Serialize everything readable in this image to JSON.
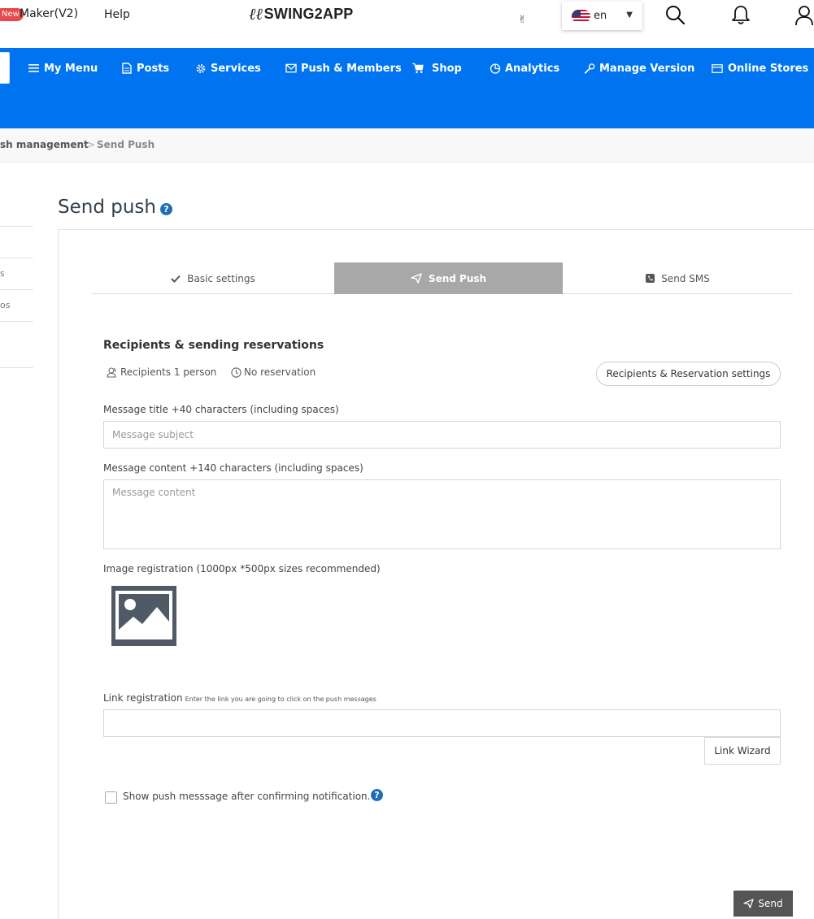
{
  "topbar": {
    "new_badge": "New",
    "maker_label": "Maker(V2)",
    "help_label": "Help",
    "logo_text": "SWING2APP",
    "language": {
      "label": "en",
      "flag": "us-flag-icon"
    },
    "icons": [
      "hand-icon",
      "search-icon",
      "bell-icon",
      "user-icon"
    ]
  },
  "nav": {
    "items": [
      {
        "label": "My Menu",
        "icon": "menu-icon"
      },
      {
        "label": "Posts",
        "icon": "document-icon"
      },
      {
        "label": "Services",
        "icon": "gear-icon"
      },
      {
        "label": "Push & Members",
        "icon": "mail-icon"
      },
      {
        "label": "Shop",
        "icon": "cart-icon"
      },
      {
        "label": "Analytics",
        "icon": "pie-chart-icon"
      },
      {
        "label": "Manage Version",
        "icon": "wrench-icon"
      },
      {
        "label": "Online Stores",
        "icon": "store-icon"
      }
    ]
  },
  "breadcrumb": {
    "parent": "sh management",
    "separator": ">",
    "current": "Send Push"
  },
  "sidebar": {
    "fragments": [
      "s",
      "os"
    ]
  },
  "page": {
    "title": "Send push"
  },
  "tabs": [
    {
      "label": "Basic settings",
      "icon": "check-icon",
      "active": false
    },
    {
      "label": "Send Push",
      "icon": "send-icon",
      "active": true
    },
    {
      "label": "Send SMS",
      "icon": "phone-icon",
      "active": false
    }
  ],
  "recipients": {
    "section_title": "Recipients & sending reservations",
    "recipients_text": "Recipients 1 person",
    "reservation_text": "No reservation",
    "settings_button": "Recipients & Reservation settings"
  },
  "form": {
    "title_label": "Message title +40 characters (including spaces)",
    "title_placeholder": "Message subject",
    "content_label": "Message content +140 characters (including spaces)",
    "content_placeholder": "Message content",
    "image_label": "Image registration (1000px *500px sizes recommended)",
    "link_label": "Link registration",
    "link_hint": "Enter the link you are going to click on the push messages",
    "link_value": "",
    "link_wizard_button": "Link Wizard",
    "checkbox_label": "Show push messsage after confirming notification.",
    "checkbox_checked": false,
    "send_button": "Send"
  },
  "colors": {
    "nav_bg": "#0074f0",
    "active_tab": "#a8a8a8",
    "send_button": "#555555",
    "badge": "#e8474c",
    "help_icon": "#1f6fb8"
  }
}
